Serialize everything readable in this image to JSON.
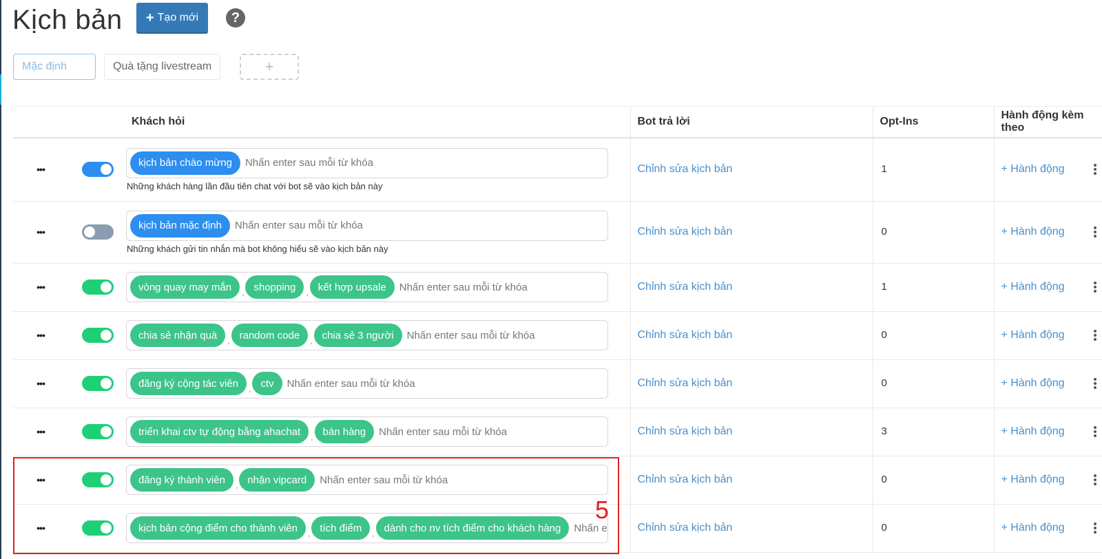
{
  "page": {
    "title": "Kịch bản",
    "create_button": "Tạo mới",
    "help": "?"
  },
  "tabs": [
    {
      "label": "Mặc định",
      "active": true
    },
    {
      "label": "Quà tặng livestream",
      "active": false
    },
    {
      "label": "+",
      "add": true
    }
  ],
  "table": {
    "headers": {
      "keywords": "Khách hỏi",
      "bot": "Bot trả lời",
      "optins": "Opt-Ins",
      "actions": "Hành động kèm theo"
    },
    "placeholder": "Nhấn enter sau mỗi từ khóa",
    "placeholder_truncated": "Nhấn e",
    "edit_label": "Chỉnh sửa kịch bản",
    "action_label": "+ Hành động",
    "rows": [
      {
        "enabled": true,
        "toggle_color": "blue",
        "tags": [
          "kịch bản chào mừng"
        ],
        "tag_color": "blue",
        "note": "Những khách hàng lần đầu tiên chat với bot sẽ vào kịch bản này",
        "optins": "1"
      },
      {
        "enabled": false,
        "toggle_color": "gray",
        "tags": [
          "kịch bản mặc định"
        ],
        "tag_color": "blue",
        "note": "Những khách gửi tin nhắn mà bot không hiểu sẽ vào kịch bản này",
        "optins": "0"
      },
      {
        "enabled": true,
        "toggle_color": "green",
        "tags": [
          "vòng quay may mắn",
          "shopping",
          "kết hợp upsale"
        ],
        "tag_color": "green",
        "optins": "1"
      },
      {
        "enabled": true,
        "toggle_color": "green",
        "tags": [
          "chia sẻ nhận quà",
          "random code",
          "chia sẻ 3 người"
        ],
        "tag_color": "green",
        "optins": "0"
      },
      {
        "enabled": true,
        "toggle_color": "green",
        "tags": [
          "đăng ký cộng tác viên",
          "ctv"
        ],
        "tag_color": "green",
        "optins": "0"
      },
      {
        "enabled": true,
        "toggle_color": "green",
        "tags": [
          "triển khai ctv tự động bằng ahachat",
          "bán hàng"
        ],
        "tag_color": "green",
        "optins": "3"
      },
      {
        "enabled": true,
        "toggle_color": "green",
        "tags": [
          "đăng ký thành viên",
          "nhận vipcard"
        ],
        "tag_color": "green",
        "optins": "0"
      },
      {
        "enabled": true,
        "toggle_color": "green",
        "tags": [
          "kịch bản cộng điểm cho thành viên",
          "tích điểm",
          "dành cho nv tích điểm cho khách hàng"
        ],
        "tag_color": "green",
        "optins": "0",
        "truncated": true
      }
    ]
  },
  "annotation": {
    "number": "5",
    "color": "#e02020"
  },
  "colors": {
    "primary": "#337ab7",
    "tag_blue": "#2d8ef0",
    "tag_green": "#3cc48b",
    "toggle_green": "#1fcf76",
    "link": "#4a8fc9"
  }
}
